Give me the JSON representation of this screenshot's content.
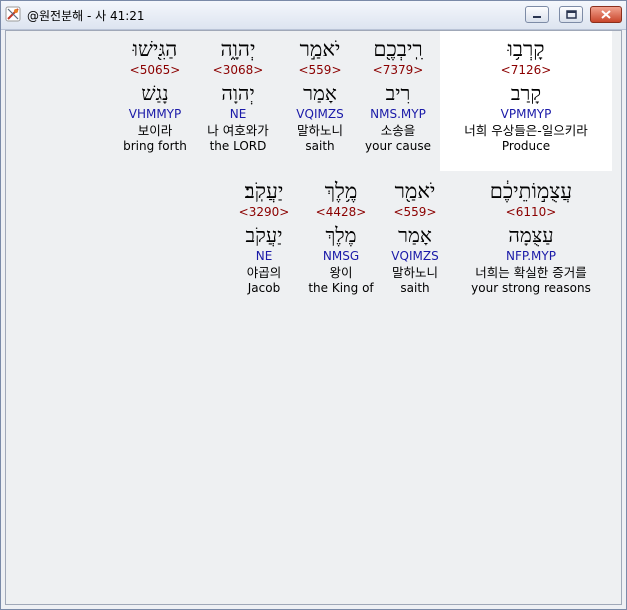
{
  "window": {
    "title": "@원전분해 - 사 41:21"
  },
  "titlebar_buttons": {
    "minimize": "minimize-icon",
    "maximize": "maximize-icon",
    "close": "close-icon"
  },
  "rows": [
    {
      "words": [
        {
          "hebrew": "הַגִּ֖ישׁוּ",
          "strong": "<5065>",
          "lemma": "נָגַשׁ",
          "morph": "VHMMYP",
          "korean": "보이라",
          "english": "bring forth"
        },
        {
          "hebrew": "יְהוָ֑ה",
          "strong": "<3068>",
          "lemma": "יְהוָה",
          "morph": "NE",
          "korean": "나 여호와가",
          "english": "the LORD"
        },
        {
          "hebrew": "יֹאמַ֣ר",
          "strong": "<559>",
          "lemma": "אָמַר",
          "morph": "VQIMZS",
          "korean": "말하노니",
          "english": "saith"
        },
        {
          "hebrew": "רִֽיבְכֶ֖ם",
          "strong": "<7379>",
          "lemma": "רִיב",
          "morph": "NMS.MYP",
          "korean": "소송을",
          "english": "your cause"
        },
        {
          "hebrew": "קָרְב֥וּ",
          "strong": "<7126>",
          "lemma": "קָרַב",
          "morph": "VPMMYP",
          "korean": "너희 우상들은-일으키라",
          "english": "Produce",
          "selected": true
        }
      ]
    },
    {
      "words": [
        {
          "hebrew": "יַעֲקֹֽב׃",
          "strong": "<3290>",
          "lemma": "יַעֲקֹב",
          "morph": "NE",
          "korean": "야곱의",
          "english": "Jacob"
        },
        {
          "hebrew": "מֶ֥לֶךְ",
          "strong": "<4428>",
          "lemma": "מֶלֶךְ",
          "morph": "NMSG",
          "korean": "왕이",
          "english": "the King of"
        },
        {
          "hebrew": "יֹאמַ֖ר",
          "strong": "<559>",
          "lemma": "אָמַר",
          "morph": "VQIMZS",
          "korean": "말하노니",
          "english": "saith"
        },
        {
          "hebrew": "עֲצֻמ֣וֹתֵיכֶ֔ם",
          "strong": "<6110>",
          "lemma": "עַצֻּמָה",
          "morph": "NFP.MYP",
          "korean": "너희는 확실한 증거를",
          "english": "your strong reasons"
        }
      ]
    }
  ]
}
